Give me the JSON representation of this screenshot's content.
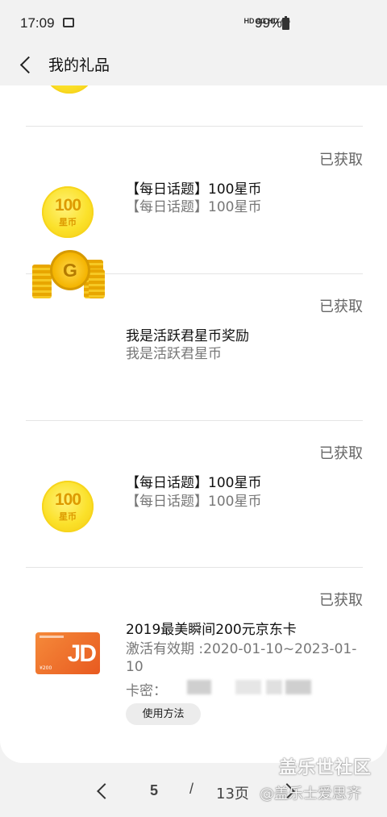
{
  "status_bar": {
    "time": "17:09",
    "network": "HD 4G HD 4G",
    "battery": "99%"
  },
  "header": {
    "title": "我的礼品"
  },
  "gifts": [
    {
      "status": "已获取",
      "title": "【每日话题】100星币",
      "subtitle": "【每日话题】100星币",
      "icon": {
        "number": "100",
        "unit": "星币"
      }
    },
    {
      "status": "已获取",
      "title": "我是活跃君星币奖励",
      "subtitle": "我是活跃君星币",
      "icon": {
        "letter": "G"
      }
    },
    {
      "status": "已获取",
      "title": "【每日话题】100星币",
      "subtitle": "【每日话题】100星币",
      "icon": {
        "number": "100",
        "unit": "星币"
      }
    },
    {
      "status": "已获取",
      "title": "2019最美瞬间200元京东卡",
      "subtitle": "激活有效期 :2020-01-10~2023-01-10",
      "secret_label": "卡密：",
      "howto_button": "使用方法",
      "icon": {
        "text": "JD"
      }
    }
  ],
  "pagination": {
    "current": "5",
    "separator": "/",
    "total": "13页"
  },
  "watermark": {
    "line1": "盖乐世社区",
    "line2": "@盖乐士爱思齐"
  }
}
